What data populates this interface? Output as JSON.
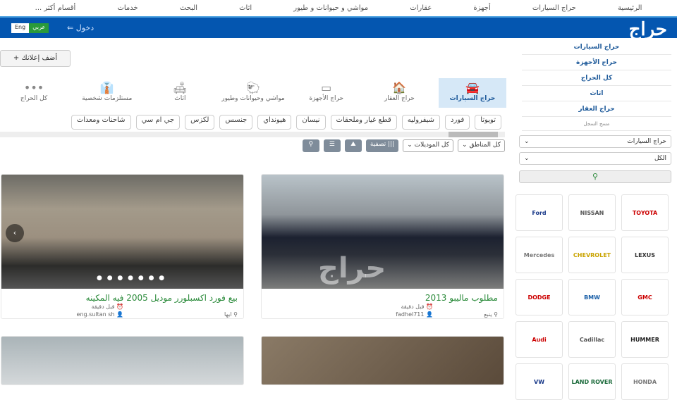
{
  "topnav": [
    "الرئيسية",
    "حراج السيارات",
    "أجهزة",
    "عقارات",
    "مواشي و حيوانات و طيور",
    "اثاث",
    "البحث",
    "خدمات",
    "أقسام أكثر ..."
  ],
  "header": {
    "logo": "حراج",
    "login": "دخول",
    "lang_ar": "عربي",
    "lang_en": "Eng"
  },
  "sidebar": {
    "links": [
      "حراج السيارات",
      "حراج الأجهزة",
      "كل الحراج",
      "اثاث",
      "حراج العقار"
    ],
    "clear": "مسح السجل",
    "select1": "حراج السيارات",
    "select2": "الكل",
    "search": "⚲"
  },
  "brands": [
    "TOYOTA",
    "NISSAN",
    "Ford",
    "LEXUS",
    "CHEVROLET",
    "Mercedes",
    "GMC",
    "BMW",
    "DODGE",
    "HUMMER",
    "Cadillac",
    "Audi",
    "HONDA",
    "LAND ROVER",
    "VW"
  ],
  "add_button": "+ أضف إعلانك",
  "categories": [
    {
      "label": "حراج السيارات",
      "icon": "🚘"
    },
    {
      "label": "حراج العقار",
      "icon": "🏠"
    },
    {
      "label": "حراج الأجهزة",
      "icon": "▭"
    },
    {
      "label": "مواشي وحيوانات وطيور",
      "icon": "🐑"
    },
    {
      "label": "اثاث",
      "icon": "🛋"
    },
    {
      "label": "مستلزمات شخصية",
      "icon": "👔"
    },
    {
      "label": "كل الحراج",
      "icon": "•••"
    }
  ],
  "tags": [
    "تويوتا",
    "فورد",
    "شيفروليه",
    "قطع غيار وملحقات",
    "نيسان",
    "هيونداي",
    "جنسس",
    "لكزس",
    "جي ام سي",
    "شاحنات ومعدات"
  ],
  "filters": {
    "region": "كل المناطق",
    "model": "كل الموديلات",
    "filter": "تصفية"
  },
  "listings": [
    {
      "title": "مطلوب ماليبو 2013",
      "time": "قبل دقيقة",
      "user": "fadhel711",
      "location": "ينبع"
    },
    {
      "title": "بيع فورد اكسبلورر موديل 2005 فيه المكينه",
      "time": "قبل دقيقة",
      "user": "eng.sultan sh",
      "location": "ابها"
    }
  ],
  "watermark": "حراج"
}
